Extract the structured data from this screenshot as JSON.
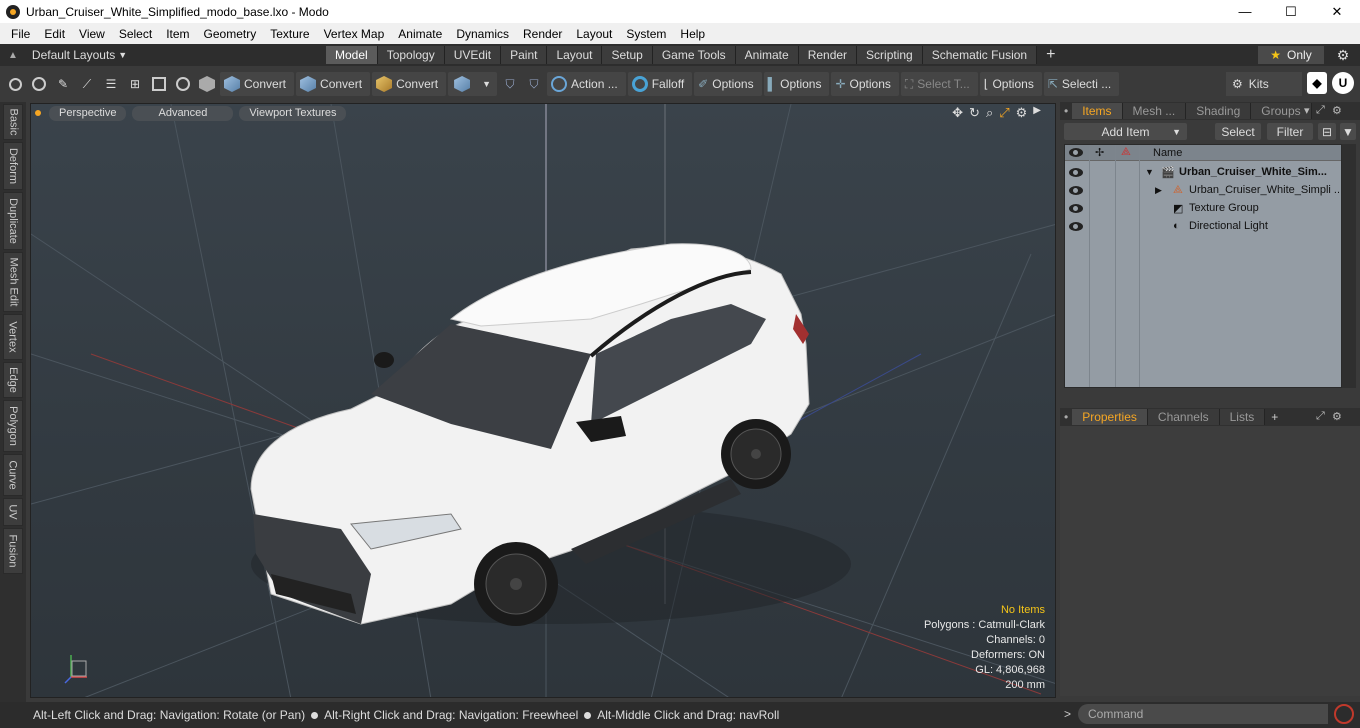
{
  "window": {
    "title": "Urban_Cruiser_White_Simplified_modo_base.lxo - Modo",
    "minimize": "—",
    "maximize": "☐",
    "close": "✕"
  },
  "menu": [
    "File",
    "Edit",
    "View",
    "Select",
    "Item",
    "Geometry",
    "Texture",
    "Vertex Map",
    "Animate",
    "Dynamics",
    "Render",
    "Layout",
    "System",
    "Help"
  ],
  "layouts": {
    "label": "Default Layouts",
    "tabs": [
      "Model",
      "Topology",
      "UVEdit",
      "Paint",
      "Layout",
      "Setup",
      "Game Tools",
      "Animate",
      "Render",
      "Scripting",
      "Schematic Fusion"
    ],
    "active": "Model",
    "plus": "+",
    "only_label": "Only"
  },
  "toolbar": {
    "convert1": "Convert",
    "convert2": "Convert",
    "convert3": "Convert",
    "action": "Action ...",
    "falloff": "Falloff",
    "options1": "Options",
    "options2": "Options",
    "options3": "Options",
    "select_t": "Select T...",
    "options4": "Options",
    "selecti": "Selecti ...",
    "kits": "Kits"
  },
  "left_tabs": [
    "Basic",
    "Deform",
    "Duplicate",
    "Mesh Edit",
    "Vertex",
    "Edge",
    "Polygon",
    "Curve",
    "UV",
    "Fusion"
  ],
  "viewport": {
    "perspective": "Perspective",
    "advanced": "Advanced",
    "textures": "Viewport Textures",
    "stats": {
      "no_items": "No Items",
      "polygons": "Polygons : Catmull-Clark",
      "channels": "Channels: 0",
      "deformers": "Deformers: ON",
      "gl": "GL: 4,806,968",
      "scale": "200 mm"
    }
  },
  "items_panel": {
    "tabs": [
      "Items",
      "Mesh ...",
      "Shading",
      "Groups"
    ],
    "add_item": "Add Item",
    "select": "Select",
    "filter": "Filter",
    "col_name": "Name",
    "rows": [
      {
        "label": "Urban_Cruiser_White_Sim...",
        "indent": 0
      },
      {
        "label": "Urban_Cruiser_White_Simpli ...",
        "indent": 1
      },
      {
        "label": "Texture Group",
        "indent": 1
      },
      {
        "label": "Directional Light",
        "indent": 1
      }
    ]
  },
  "props_panel": {
    "tabs": [
      "Properties",
      "Channels",
      "Lists"
    ],
    "plus": "+"
  },
  "status": {
    "hint1": "Alt-Left Click and Drag: Navigation: Rotate (or Pan)",
    "hint2": "Alt-Right Click and Drag: Navigation: Freewheel",
    "hint3": "Alt-Middle Click and Drag: navRoll",
    "command_placeholder": "Command"
  },
  "colors": {
    "accent": "#f5a623",
    "viewport_bg": "#343c43",
    "car_body": "#f2f2f2"
  }
}
